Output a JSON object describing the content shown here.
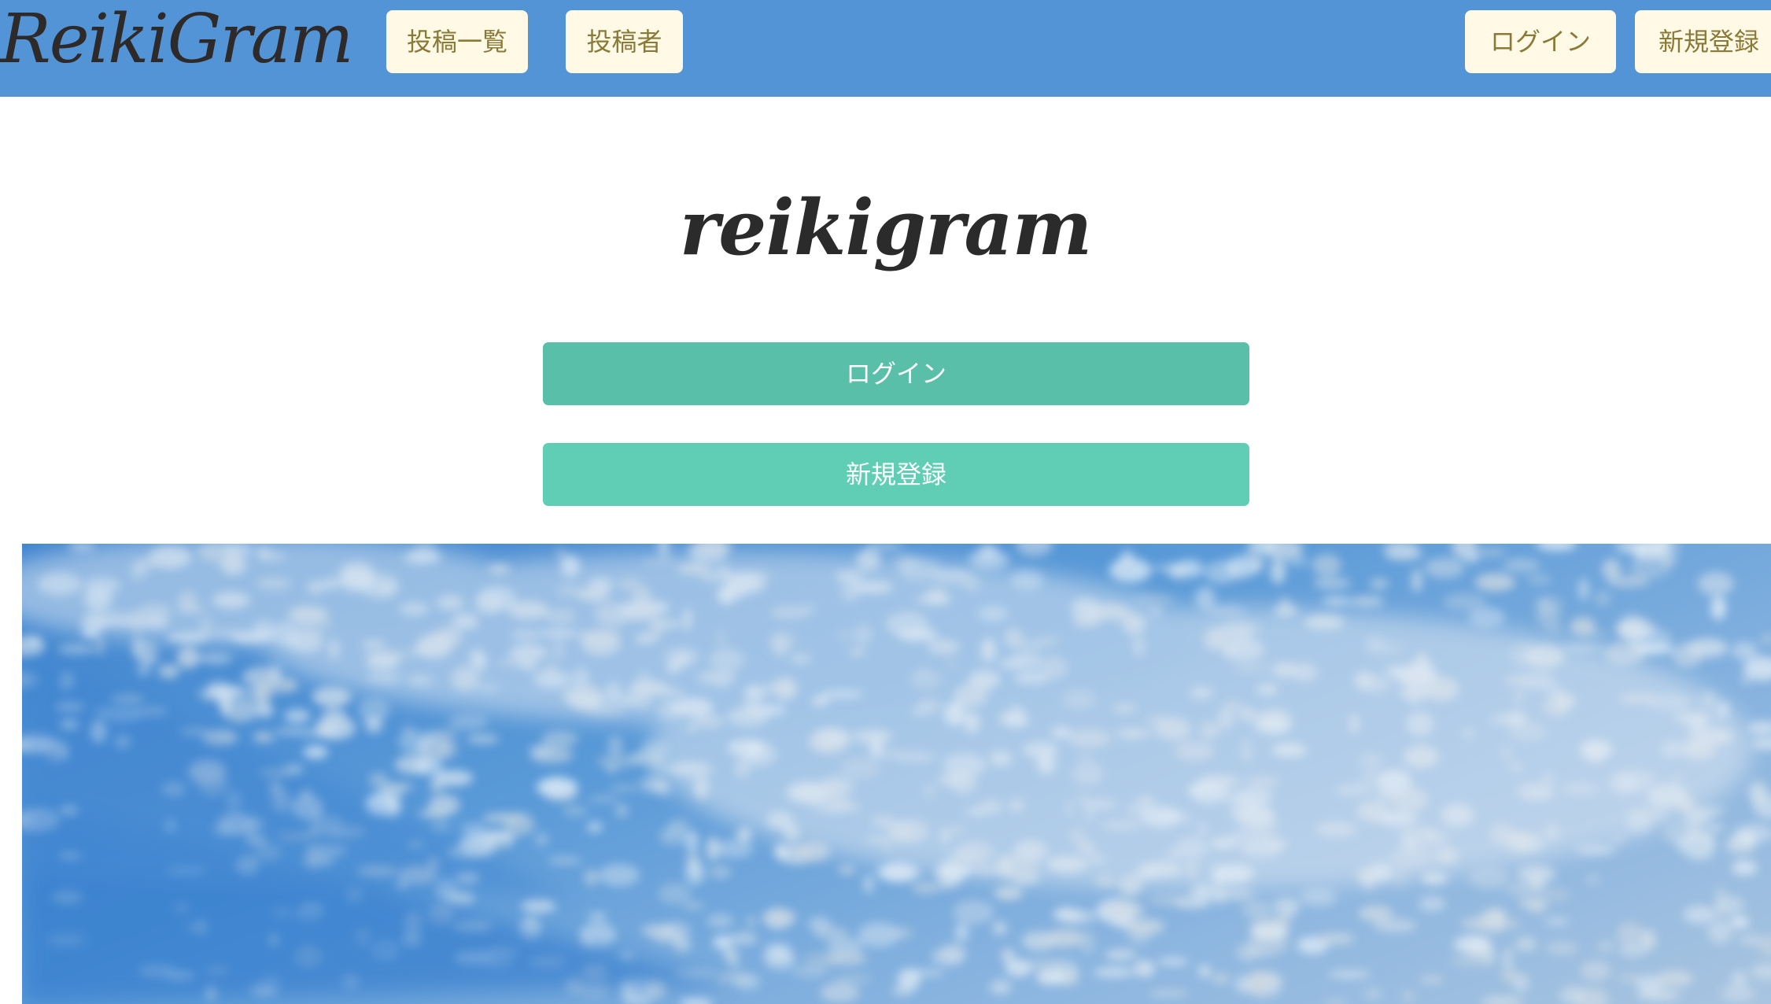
{
  "header": {
    "brand": "ReikiGram",
    "nav_left": [
      "投稿一覧",
      "投稿者"
    ],
    "nav_right": [
      "ログイン",
      "新規登録"
    ]
  },
  "hero": {
    "title": "reikigram",
    "login_label": "ログイン",
    "signup_label": "新規登録"
  },
  "colors": {
    "navbar": "#5294d6",
    "nav_button_bg": "#fff9e6",
    "nav_button_text": "#8a7a38",
    "login_button": "#59bfa9",
    "signup_button": "#5fceb4"
  }
}
